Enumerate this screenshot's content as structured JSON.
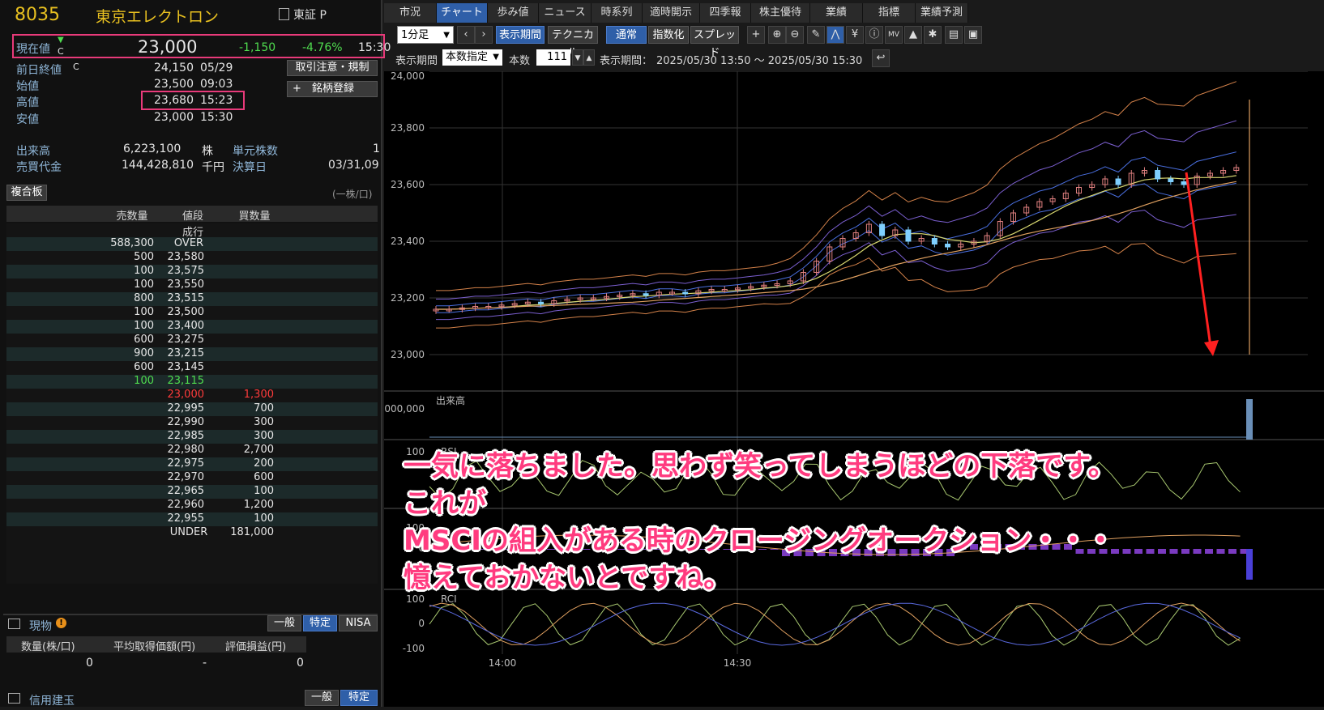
{
  "stock": {
    "code": "8035",
    "name": "東京エレクトロン",
    "market": "東証 P"
  },
  "quote": {
    "current_label": "現在値",
    "current_mark": "C",
    "current_price": "23,000",
    "change": "-1,150",
    "change_pct": "-4.76%",
    "current_time": "15:30",
    "prev_close_label": "前日終値",
    "prev_close_mark": "C",
    "prev_close": "24,150",
    "prev_close_date": "05/29",
    "open_label": "始値",
    "open": "23,500",
    "open_time": "09:03",
    "high_label": "高値",
    "high": "23,680",
    "high_time": "15:23",
    "low_label": "安値",
    "low": "23,000",
    "low_time": "15:30",
    "volume_label": "出来高",
    "volume": "6,223,100",
    "volume_unit": "株",
    "unit_label": "単元株数",
    "unit_value": "1",
    "turnover_label": "売買代金",
    "turnover": "144,428,810",
    "turnover_unit": "千円",
    "fiscal_label": "決算日",
    "fiscal_value": "03/31,09"
  },
  "buttons": {
    "notice": "取引注意・規制",
    "register": "銘柄登録",
    "register_plus": "+"
  },
  "board": {
    "title": "複合板",
    "unit": "(一株/口)",
    "headers": [
      "売数量",
      "値段",
      "買数量"
    ],
    "market_order": "成行",
    "rows": [
      {
        "sell": "588,300",
        "price": "OVER",
        "buy": ""
      },
      {
        "sell": "500",
        "price": "23,580",
        "buy": ""
      },
      {
        "sell": "100",
        "price": "23,575",
        "buy": ""
      },
      {
        "sell": "100",
        "price": "23,550",
        "buy": ""
      },
      {
        "sell": "800",
        "price": "23,515",
        "buy": ""
      },
      {
        "sell": "100",
        "price": "23,500",
        "buy": ""
      },
      {
        "sell": "100",
        "price": "23,400",
        "buy": ""
      },
      {
        "sell": "600",
        "price": "23,275",
        "buy": ""
      },
      {
        "sell": "900",
        "price": "23,215",
        "buy": ""
      },
      {
        "sell": "600",
        "price": "23,145",
        "buy": ""
      },
      {
        "sell": "100",
        "price": "23,115",
        "buy": ""
      },
      {
        "sell": "",
        "price": "23,000",
        "buy": "1,300"
      },
      {
        "sell": "",
        "price": "22,995",
        "buy": "700"
      },
      {
        "sell": "",
        "price": "22,990",
        "buy": "300"
      },
      {
        "sell": "",
        "price": "22,985",
        "buy": "300"
      },
      {
        "sell": "",
        "price": "22,980",
        "buy": "2,700"
      },
      {
        "sell": "",
        "price": "22,975",
        "buy": "200"
      },
      {
        "sell": "",
        "price": "22,970",
        "buy": "600"
      },
      {
        "sell": "",
        "price": "22,965",
        "buy": "100"
      },
      {
        "sell": "",
        "price": "22,960",
        "buy": "1,200"
      },
      {
        "sell": "",
        "price": "22,955",
        "buy": "100"
      },
      {
        "sell": "",
        "price": "UNDER",
        "buy": "181,000"
      }
    ]
  },
  "holdings": {
    "title": "現物",
    "tabs": [
      "一般",
      "特定",
      "NISA"
    ],
    "headers": [
      "数量(株/口)",
      "平均取得価額(円)",
      "評価損益(円)"
    ],
    "values": [
      "0",
      "-",
      "0"
    ]
  },
  "margin": {
    "title": "信用建玉",
    "tabs": [
      "一般",
      "特定"
    ]
  },
  "tabs": [
    "市況",
    "チャート",
    "歩み値",
    "ニュース",
    "時系列",
    "適時開示",
    "四季報",
    "株主優待",
    "業績",
    "指標",
    "業績予測"
  ],
  "toolbar": {
    "interval": "1分足",
    "display_period": "表示期間",
    "technical": "テクニカル",
    "normal": "通常",
    "index": "指数化",
    "spread": "スプレッド",
    "period_label": "表示期間",
    "period_mode": "本数指定",
    "count_label": "本数",
    "count_value": "111",
    "range_label": "表示期間：",
    "range_value": "2025/05/30 13:50 ～ 2025/05/30 15:30"
  },
  "chart_data": {
    "type": "candlestick",
    "price_ylim": [
      23000,
      24000
    ],
    "price_ticks": [
      "24,000",
      "23,800",
      "23,600",
      "23,400",
      "23,200",
      "23,000"
    ],
    "x_ticks": [
      "14:00",
      "14:30"
    ],
    "volume_label": "出来高",
    "volume_tick": "2,000,000",
    "rsi_label": "RSI",
    "rsi_ticks": [
      "100",
      "0"
    ],
    "macd_ticks": [
      "100",
      "0",
      "-100"
    ],
    "rci_label": "RCI",
    "rci_ticks": [
      "100",
      "0",
      "-100"
    ],
    "close_series": [
      23160,
      23160,
      23165,
      23170,
      23170,
      23175,
      23180,
      23185,
      23180,
      23190,
      23195,
      23200,
      23200,
      23205,
      23210,
      23215,
      23210,
      23220,
      23220,
      23215,
      23225,
      23230,
      23230,
      23235,
      23240,
      23245,
      23250,
      23260,
      23290,
      23330,
      23380,
      23410,
      23430,
      23460,
      23420,
      23440,
      23400,
      23410,
      23390,
      23380,
      23390,
      23400,
      23420,
      23470,
      23500,
      23520,
      23540,
      23550,
      23570,
      23590,
      23600,
      23620,
      23600,
      23640,
      23650,
      23620,
      23610,
      23600,
      23630,
      23640,
      23650,
      23660,
      23000
    ]
  },
  "annotation": {
    "line1": "一気に落ちました。思わず笑ってしまうほどの下落です。",
    "line2": "これが",
    "line3": "MSCIの組入がある時のクロージングオークション・・・",
    "line4": "憶えておかないとですね。"
  },
  "colors": {
    "accent": "#2f5fa8",
    "highlight": "#e83a7a",
    "up": "#4fdc4f",
    "down": "#ff3b3b",
    "ticker": "#e8c020"
  }
}
